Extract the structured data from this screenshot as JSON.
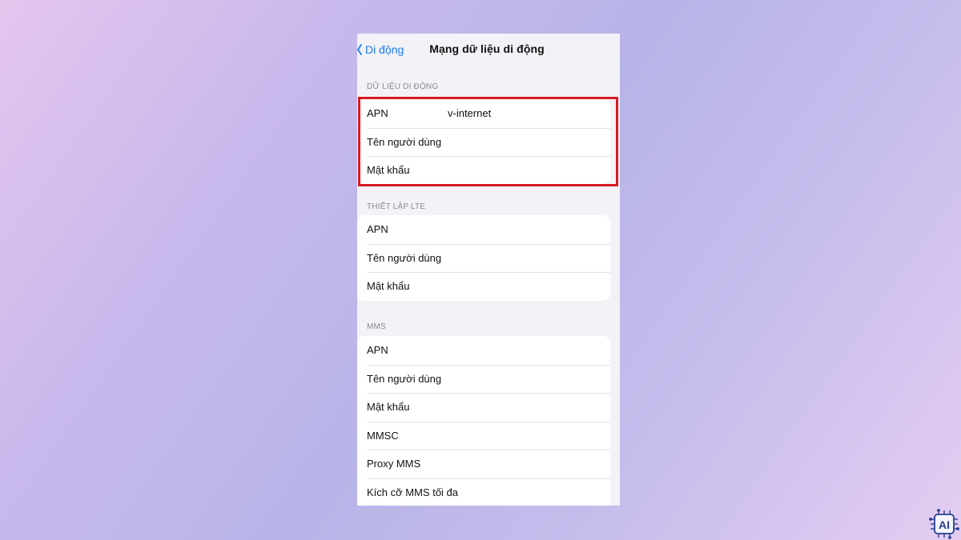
{
  "navbar": {
    "back_label": "Di động",
    "title": "Mạng dữ liệu di động"
  },
  "sections": [
    {
      "header": "DỮ LIỆU DI ĐỘNG",
      "rows": [
        {
          "label": "APN",
          "value": "v-internet"
        },
        {
          "label": "Tên người dùng",
          "value": ""
        },
        {
          "label": "Mật khẩu",
          "value": ""
        }
      ]
    },
    {
      "header": "THIẾT LẬP LTE",
      "rows": [
        {
          "label": "APN",
          "value": ""
        },
        {
          "label": "Tên người dùng",
          "value": ""
        },
        {
          "label": "Mật khẩu",
          "value": ""
        }
      ]
    },
    {
      "header": "MMS",
      "rows": [
        {
          "label": "APN",
          "value": ""
        },
        {
          "label": "Tên người dùng",
          "value": ""
        },
        {
          "label": "Mật khẩu",
          "value": ""
        },
        {
          "label": "MMSC",
          "value": ""
        },
        {
          "label": "Proxy MMS",
          "value": ""
        },
        {
          "label": "Kích cỡ MMS tối đa",
          "value": ""
        }
      ]
    }
  ],
  "badge": {
    "text": "AI"
  },
  "colors": {
    "accent": "#1e7cf2",
    "highlight_border": "#d81b22",
    "badge": "#2a3f8f"
  }
}
